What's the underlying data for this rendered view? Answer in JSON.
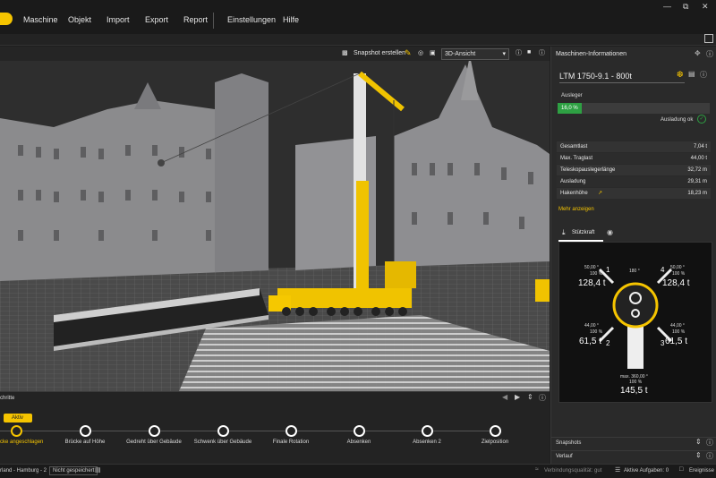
{
  "menu": {
    "items": [
      "Maschine",
      "Objekt",
      "Import",
      "Export",
      "Report",
      "Einstellungen",
      "Hilfe"
    ]
  },
  "viewport": {
    "snapshot_label": "Snapshot erstellen",
    "view_select": "3D-Ansicht"
  },
  "panel": {
    "title": "Maschinen-Informationen",
    "machine_name": "LTM 1750-9.1 - 800t",
    "ausleger_label": "Ausleger",
    "ausleger_percent": "16,0 %",
    "ausleger_fraction": 0.16,
    "ausladung_ok": "Ausladung ok",
    "specs": [
      {
        "label": "Gesamtlast",
        "value": "7,04 t"
      },
      {
        "label": "Max. Traglast",
        "value": "44,00 t"
      },
      {
        "label": "Teleskopauslegerlänge",
        "value": "32,72 m"
      },
      {
        "label": "Ausladung",
        "value": "29,31 m"
      },
      {
        "label": "Hakenhöhe",
        "value": "18,23 m"
      }
    ],
    "mehr_anzeigen": "Mehr anzeigen",
    "tab_stuetzkraft": "Stützkraft",
    "outriggers": {
      "o1": {
        "angle": "50,00 °",
        "pct": "100 %",
        "num": "1",
        "value": "128,4 t"
      },
      "o4": {
        "angle": "50,00 °",
        "pct": "100 %",
        "num": "4",
        "value": "128,4 t"
      },
      "o2": {
        "angle": "44,00 °",
        "pct": "100 %",
        "num": "2",
        "value": "61,5 t"
      },
      "o3": {
        "angle": "44,00 °",
        "pct": "100 %",
        "num": "3",
        "value": "61,5 t"
      },
      "top_angle": "180 °",
      "bottom_label": "max. 360,00 °",
      "bottom_pct": "100 %",
      "bottom_value": "145,5 t"
    },
    "snapshots": "Snapshots",
    "verlauf": "Verlauf"
  },
  "timeline": {
    "title": "chritte",
    "active_badge": "Aktiv",
    "steps": [
      "cke angeschlagen",
      "Brücke auf Höhe",
      "Gedreht über Gebäude",
      "Schwenk über Gebäude",
      "Finale Rotation",
      "Absenken",
      "Absenken 2",
      "Zielposition"
    ]
  },
  "status": {
    "project": "rland - Hamburg - 2",
    "not_saved": "Nicht gespeichert",
    "connection": "Verbindungsqualität: gut",
    "active_tasks": "Aktive Aufgaben: 0",
    "events": "Ereignisse"
  },
  "colors": {
    "accent": "#f5c400",
    "good": "#2ea043",
    "bar_bg": "#3c3c3c"
  }
}
